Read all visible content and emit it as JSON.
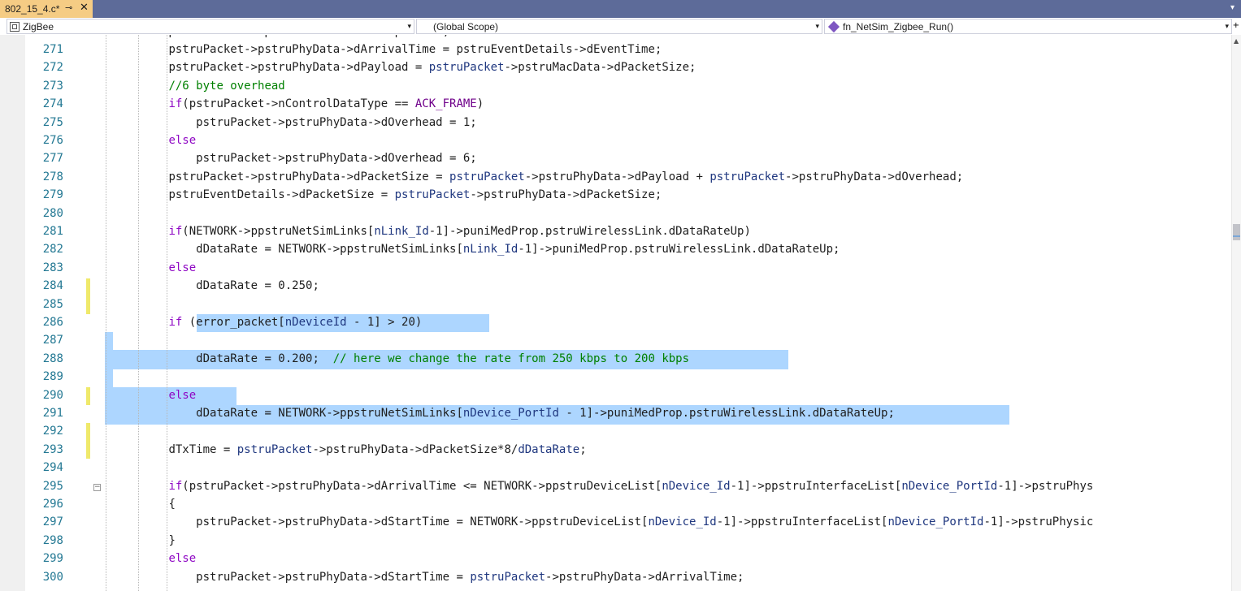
{
  "tab": {
    "title": "802_15_4.c*",
    "pin_glyph": "⊸",
    "close_glyph": "✕",
    "overflow_glyph": "▾",
    "accent": "#f5cc84"
  },
  "navbar": {
    "project": "ZigBee",
    "scope": "(Global Scope)",
    "function": "fn_NetSim_Zigbee_Run()",
    "arrow": "▾"
  },
  "editor": {
    "first_line_partial": "pstruPacket = pstruEventDetails->pPacket;",
    "lines": [
      {
        "n": "271",
        "code": [
          [
            "t",
            "pstruPacket->pstruPhyData->dArrivalTime = pstruEventDetails->dEventTime;"
          ]
        ]
      },
      {
        "n": "272",
        "code": [
          [
            "t",
            "pstruPacket->pstruPhyData->dPayload = "
          ],
          [
            "id",
            "pstruPacket"
          ],
          [
            "t",
            "->pstruMacData->dPacketSize;"
          ]
        ]
      },
      {
        "n": "273",
        "code": [
          [
            "cm",
            "//6 byte overhead"
          ]
        ]
      },
      {
        "n": "274",
        "code": [
          [
            "kw",
            "if"
          ],
          [
            "t",
            "(pstruPacket->nControlDataType == "
          ],
          [
            "mc",
            "ACK_FRAME"
          ],
          [
            "t",
            ")"
          ]
        ]
      },
      {
        "n": "275",
        "code": [
          [
            "t",
            "    pstruPacket->pstruPhyData->dOverhead = 1;"
          ]
        ]
      },
      {
        "n": "276",
        "code": [
          [
            "kw",
            "else"
          ]
        ]
      },
      {
        "n": "277",
        "code": [
          [
            "t",
            "    pstruPacket->pstruPhyData->dOverhead = 6;"
          ]
        ]
      },
      {
        "n": "278",
        "code": [
          [
            "t",
            "pstruPacket->pstruPhyData->dPacketSize = "
          ],
          [
            "id",
            "pstruPacket"
          ],
          [
            "t",
            "->pstruPhyData->dPayload + "
          ],
          [
            "id",
            "pstruPacket"
          ],
          [
            "t",
            "->pstruPhyData->dOverhead;"
          ]
        ]
      },
      {
        "n": "279",
        "code": [
          [
            "t",
            "pstruEventDetails->dPacketSize = "
          ],
          [
            "id",
            "pstruPacket"
          ],
          [
            "t",
            "->pstruPhyData->dPacketSize;"
          ]
        ]
      },
      {
        "n": "280",
        "code": [
          [
            "t",
            ""
          ]
        ]
      },
      {
        "n": "281",
        "code": [
          [
            "kw",
            "if"
          ],
          [
            "t",
            "(NETWORK->ppstruNetSimLinks["
          ],
          [
            "id",
            "nLink_Id"
          ],
          [
            "t",
            "-1]->puniMedProp.pstruWirelessLink.dDataRateUp)"
          ]
        ]
      },
      {
        "n": "282",
        "code": [
          [
            "t",
            "    dDataRate = NETWORK->ppstruNetSimLinks["
          ],
          [
            "id",
            "nLink_Id"
          ],
          [
            "t",
            "-1]->puniMedProp.pstruWirelessLink.dDataRateUp;"
          ]
        ]
      },
      {
        "n": "283",
        "code": [
          [
            "kw",
            "else"
          ]
        ]
      },
      {
        "n": "284",
        "code": [
          [
            "t",
            "    dDataRate = 0.250;"
          ]
        ]
      },
      {
        "n": "285",
        "code": [
          [
            "t",
            ""
          ]
        ]
      },
      {
        "n": "286",
        "code": [
          [
            "kw",
            "if"
          ],
          [
            "t",
            " (error_packet["
          ],
          [
            "id",
            "nDeviceId"
          ],
          [
            "t",
            " - 1] > 20)"
          ]
        ]
      },
      {
        "n": "287",
        "code": [
          [
            "t",
            ""
          ]
        ]
      },
      {
        "n": "288",
        "code": [
          [
            "t",
            "    dDataRate = 0.200;  "
          ],
          [
            "cm",
            "// here we change the rate from 250 kbps to 200 kbps"
          ]
        ]
      },
      {
        "n": "289",
        "code": [
          [
            "t",
            ""
          ]
        ]
      },
      {
        "n": "290",
        "code": [
          [
            "kw",
            "else"
          ]
        ]
      },
      {
        "n": "291",
        "code": [
          [
            "t",
            "    dDataRate = NETWORK->ppstruNetSimLinks["
          ],
          [
            "id",
            "nDevice_PortId"
          ],
          [
            "t",
            " - 1]->puniMedProp.pstruWirelessLink.dDataRateUp;"
          ]
        ]
      },
      {
        "n": "292",
        "code": [
          [
            "t",
            ""
          ]
        ]
      },
      {
        "n": "293",
        "code": [
          [
            "t",
            "dTxTime = "
          ],
          [
            "id",
            "pstruPacket"
          ],
          [
            "t",
            "->pstruPhyData->dPacketSize*8/"
          ],
          [
            "id",
            "dDataRate"
          ],
          [
            "t",
            ";"
          ]
        ]
      },
      {
        "n": "294",
        "code": [
          [
            "t",
            ""
          ]
        ]
      },
      {
        "n": "295",
        "code": [
          [
            "kw",
            "if"
          ],
          [
            "t",
            "(pstruPacket->pstruPhyData->dArrivalTime <= NETWORK->ppstruDeviceList["
          ],
          [
            "id",
            "nDevice_Id"
          ],
          [
            "t",
            "-1]->ppstruInterfaceList["
          ],
          [
            "id",
            "nDevice_PortId"
          ],
          [
            "t",
            "-1]->pstruPhys"
          ]
        ]
      },
      {
        "n": "296",
        "code": [
          [
            "t",
            "{"
          ]
        ]
      },
      {
        "n": "297",
        "code": [
          [
            "t",
            "    pstruPacket->pstruPhyData->dStartTime = NETWORK->ppstruDeviceList["
          ],
          [
            "id",
            "nDevice_Id"
          ],
          [
            "t",
            "-1]->ppstruInterfaceList["
          ],
          [
            "id",
            "nDevice_PortId"
          ],
          [
            "t",
            "-1]->pstruPhysic"
          ]
        ]
      },
      {
        "n": "298",
        "code": [
          [
            "t",
            "}"
          ]
        ]
      },
      {
        "n": "299",
        "code": [
          [
            "kw",
            "else"
          ]
        ]
      },
      {
        "n": "300",
        "code": [
          [
            "t",
            "    pstruPacket->pstruPhyData->dStartTime = "
          ],
          [
            "id",
            "pstruPacket"
          ],
          [
            "t",
            "->pstruPhyData->dArrivalTime;"
          ]
        ]
      }
    ]
  },
  "colors": {
    "tabstrip": "#5d6b99",
    "selection": "#add6ff",
    "keyword": "#8f08c4",
    "comment": "#008000",
    "line_number": "#237893",
    "change_marker": "#efe96b"
  },
  "icons": {
    "project": "project-icon",
    "function": "function-icon",
    "collapse": "collapse-minus-icon"
  }
}
